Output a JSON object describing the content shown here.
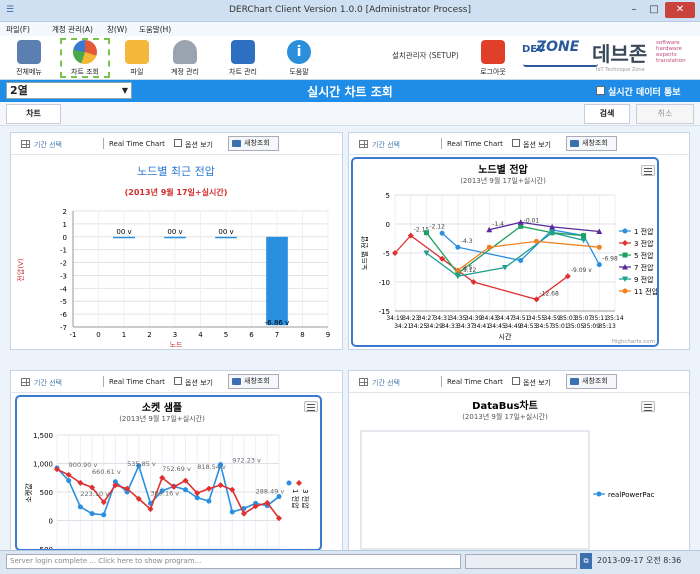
{
  "window": {
    "title": "DERChart Client Version 1.0.0 [Administrator Process]",
    "min": "–",
    "max": "□",
    "close": "✕"
  },
  "menubar": [
    {
      "label": "파일(F)"
    },
    {
      "label": "계정 관리(A)"
    },
    {
      "label": "창(W)"
    },
    {
      "label": "도움말(H)"
    }
  ],
  "toolbar": {
    "items": [
      {
        "label": "전체메뉴",
        "icon": "all-menu-icon",
        "color": "#5a7fb0"
      },
      {
        "label": "차트 조회",
        "icon": "pie-chart-icon",
        "color": "#e25a3a"
      },
      {
        "label": "파일",
        "icon": "folder-icon",
        "color": "#f3b73a"
      },
      {
        "label": "계정 관리",
        "icon": "user-icon",
        "color": "#9aa4b0"
      },
      {
        "label": "차트 관리",
        "icon": "monitor-icon",
        "color": "#2d6fc0"
      },
      {
        "label": "도움말",
        "icon": "info-icon",
        "color": "#2b8fdc"
      }
    ],
    "setup": "설치관리자 (SETUP)",
    "logout": "로그아웃",
    "logo": {
      "dev": "DEV",
      "zone": "ZONE",
      "ko": "데브존",
      "sub": [
        "software",
        "hardware",
        "experts",
        "translation"
      ],
      "tag": "IoT Technique Zone"
    }
  },
  "header": {
    "select": "2열",
    "title": "실시간 차트 조회",
    "realtime_notice": "실시간 데이터 통보"
  },
  "tabs": {
    "chart": "차트",
    "search": "검색",
    "cancel": "취소"
  },
  "panel_tool": {
    "range": "기간 선택",
    "realtime": "Real Time Chart",
    "option": "옵션 보기",
    "refresh": "새창조회"
  },
  "charts": [
    {
      "id": "c1",
      "chart_data": {
        "type": "bar",
        "title": "노드별 최근 전압",
        "subtitle": "(2013년 9월 17일+실시간)",
        "xlabel": "노드",
        "ylabel": "전압(V)",
        "xlim": [
          -1,
          9
        ],
        "ylim": [
          -7,
          2
        ],
        "xticks": [
          -1,
          0,
          1,
          2,
          3,
          4,
          5,
          6,
          7,
          8,
          9
        ],
        "yticks": [
          2,
          1,
          0,
          -1,
          -2,
          -3,
          -4,
          -5,
          -6,
          -7
        ],
        "bars": [
          {
            "x": 1,
            "value": 0,
            "label": "00 v"
          },
          {
            "x": 3,
            "value": 0,
            "label": "00 v"
          },
          {
            "x": 5,
            "value": 0,
            "label": "00 v"
          },
          {
            "x": 7,
            "value": -6.86,
            "label": "-6.86 v"
          }
        ]
      }
    },
    {
      "id": "c2",
      "chart_data": {
        "type": "line",
        "title": "노드별 전압",
        "subtitle": "(2013년 9월 17일+실시간)",
        "xlabel": "시간",
        "ylabel": "노드별 전압",
        "ylim": [
          -15,
          5
        ],
        "yticks": [
          5,
          0,
          -5,
          -10,
          -15
        ],
        "xticks_top": [
          "34:19",
          "34:23",
          "34:27",
          "34:31",
          "34:35",
          "34:39",
          "34:43",
          "34:47",
          "34:51",
          "34:55",
          "34:59",
          "35:03",
          "35:07",
          "35:11",
          "35:14"
        ],
        "xticks_bottom": [
          "34:21",
          "34:25",
          "34:29",
          "34:33",
          "34:37",
          "34:41",
          "34:45",
          "34:49",
          "34:53",
          "34:57",
          "35:01",
          "35:05",
          "35:09",
          "35:13"
        ],
        "series": [
          {
            "name": "1 전압",
            "color": "#2b8fe0",
            "marker": "circle",
            "points": [
              [
                3,
                -1.6
              ],
              [
                4,
                -4
              ],
              [
                8,
                -6.3
              ],
              [
                10,
                -1
              ],
              [
                12,
                -2
              ],
              [
                13,
                -7
              ]
            ],
            "labels": [
              "",
              "-4.3",
              "",
              "",
              "",
              "-6.98"
            ]
          },
          {
            "name": "3 전압",
            "color": "#e03030",
            "marker": "diamond",
            "points": [
              [
                0,
                -5
              ],
              [
                1,
                -2
              ],
              [
                3,
                -6
              ],
              [
                5,
                -10
              ],
              [
                9,
                -13
              ],
              [
                11,
                -9
              ]
            ],
            "labels": [
              "",
              "-2.15",
              "",
              "",
              "-12.68",
              "-9.09 v"
            ]
          },
          {
            "name": "5 전압",
            "color": "#20a060",
            "marker": "square",
            "points": [
              [
                2,
                -1.5
              ],
              [
                4,
                -8.5
              ],
              [
                8,
                -0.4
              ],
              [
                10,
                -1.5
              ],
              [
                12,
                -2
              ]
            ],
            "labels": [
              "-2.12",
              "-8.5",
              "-0.01",
              "",
              ""
            ]
          },
          {
            "name": "7 전압",
            "color": "#5a2a9a",
            "marker": "triangle",
            "points": [
              [
                6,
                -1
              ],
              [
                8,
                0.3
              ],
              [
                10,
                -0.5
              ],
              [
                13,
                -1.3
              ]
            ],
            "labels": [
              "-1.4",
              "",
              "",
              ""
            ]
          },
          {
            "name": "9 전압",
            "color": "#20a090",
            "marker": "triangle-down",
            "points": [
              [
                2,
                -5
              ],
              [
                4,
                -9
              ],
              [
                7,
                -7.5
              ],
              [
                10,
                -1.5
              ],
              [
                12,
                -2.8
              ]
            ],
            "labels": [
              "",
              "-9.12",
              "",
              "",
              ""
            ]
          },
          {
            "name": "11 전압",
            "color": "#f08020",
            "marker": "circle",
            "points": [
              [
                4,
                -8
              ],
              [
                6,
                -4
              ],
              [
                9,
                -3
              ],
              [
                13,
                -4
              ]
            ],
            "labels": [
              "",
              "",
              "",
              ""
            ]
          }
        ],
        "credit": "Highcharts.com"
      }
    },
    {
      "id": "c3",
      "chart_data": {
        "type": "line",
        "title": "소켓 샘플",
        "subtitle": "(2013년 9월 17일+실시간)",
        "ylabel": "소켓값",
        "ylim": [
          -500,
          1500
        ],
        "yticks": [
          1500,
          1000,
          500,
          0,
          -500
        ],
        "series": [
          {
            "name": "1 전압",
            "color": "#2b8fe0",
            "values": [
              920,
              700,
              240,
              120,
              100,
              680,
              500,
              960,
              300,
              520,
              600,
              540,
              400,
              340,
              980,
              150,
              210,
              300,
              260,
              420
            ]
          },
          {
            "name": "3 전압",
            "color": "#e03030",
            "values": [
              900,
              800,
              660,
              580,
              320,
              620,
              560,
              380,
              200,
              750,
              590,
              700,
              480,
              560,
              620,
              540,
              120,
              250,
              310,
              40
            ]
          }
        ],
        "labels": [
          "900.90 v",
          "660.61 v",
          "535.85 v",
          "752.69 v",
          "818.54 v",
          "972.23 v",
          "288.49 v",
          "223.10 v",
          "309.16 v"
        ]
      }
    },
    {
      "id": "c4",
      "chart_data": {
        "type": "line",
        "title": "DataBus차트",
        "subtitle": "(2013년 9월 17일+실시간)",
        "series": [
          {
            "name": "realPowerPac",
            "color": "#2b8fe0",
            "values": []
          }
        ]
      }
    }
  ],
  "status": {
    "message": "Server login complete ... Click here to show program...",
    "icon": "status-icon",
    "time": "2013-09-17 오전 8:36"
  }
}
